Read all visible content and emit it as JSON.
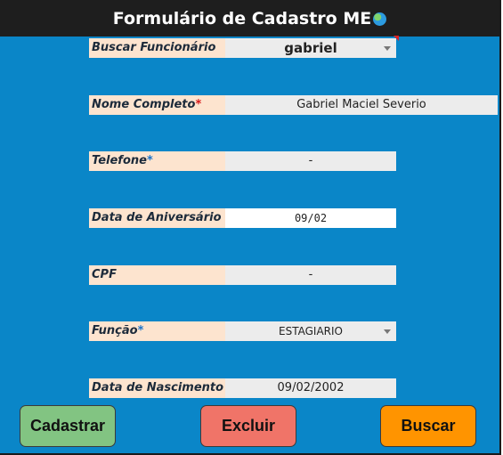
{
  "header": {
    "title": "Formulário de Cadastro ME",
    "icon": "globe-icon"
  },
  "form": {
    "buscar": {
      "label": "Buscar Funcionário",
      "value": "gabriel"
    },
    "nome": {
      "label": "Nome Completo",
      "required": "*",
      "value": "Gabriel Maciel Severio"
    },
    "telefone": {
      "label": "Telefone",
      "required": "*",
      "value": "-"
    },
    "aniversario": {
      "label": "Data de Aniversário",
      "value": "09/02"
    },
    "cpf": {
      "label": "CPF",
      "value": "-"
    },
    "funcao": {
      "label": "Função",
      "required": "*",
      "value": "ESTAGIARIO"
    },
    "nascimento": {
      "label": "Data de Nascimento",
      "value": "09/02/2002"
    }
  },
  "buttons": {
    "cadastrar": "Cadastrar",
    "excluir": "Excluir",
    "buscar": "Buscar"
  },
  "colors": {
    "background": "#0a86c8",
    "label_bg": "#fde4cf",
    "cadastrar": "#82c482",
    "excluir": "#f07468",
    "buscar": "#ff9400"
  }
}
